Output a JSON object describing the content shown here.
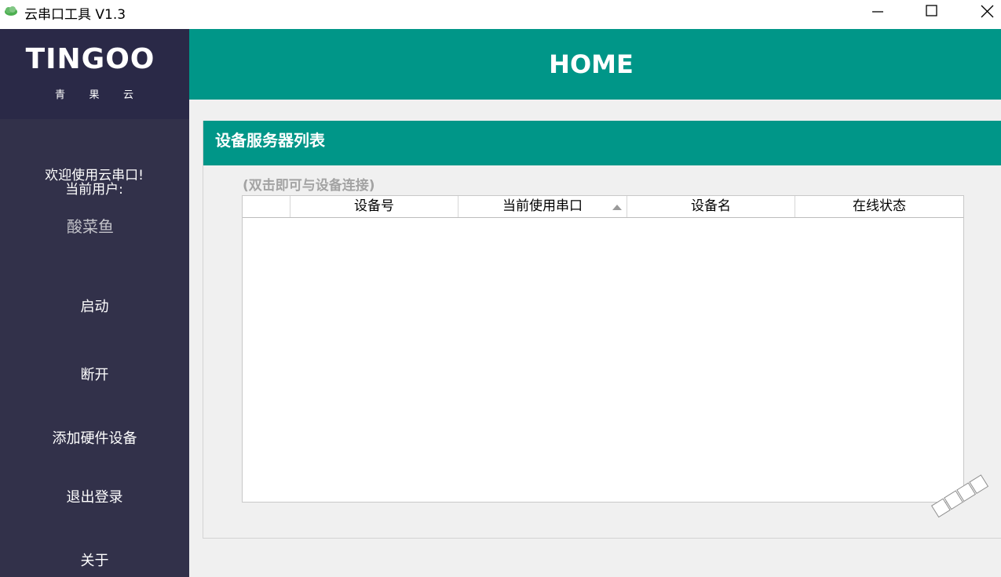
{
  "window": {
    "title": "云串口工具 V1.3",
    "icon": "cloud-icon",
    "controls": {
      "minimize": "minimize-icon",
      "maximize": "maximize-icon",
      "close": "close-icon"
    }
  },
  "sidebar": {
    "logo": "TINGOO",
    "logo_sub": [
      "青",
      "果",
      "云"
    ],
    "welcome_line1": "欢迎使用云串口!",
    "welcome_line2": "当前用户:",
    "username": "酸菜鱼",
    "nav": [
      {
        "label": "启动"
      },
      {
        "label": "断开"
      },
      {
        "label": "添加硬件设备"
      },
      {
        "label": "退出登录"
      },
      {
        "label": "关于"
      }
    ]
  },
  "header": {
    "title": "HOME"
  },
  "panel": {
    "title": "设备服务器列表",
    "hint": "(双击即可与设备连接)",
    "table": {
      "columns": [
        "",
        "设备号",
        "当前使用串口",
        "设备名",
        "在线状态"
      ],
      "sorted_column": "当前使用串口",
      "rows": []
    }
  },
  "colors": {
    "accent": "#009688",
    "sidebar_bg": "#32314a",
    "logo_bg": "#2a2947",
    "content_bg": "#f0f0f0"
  }
}
